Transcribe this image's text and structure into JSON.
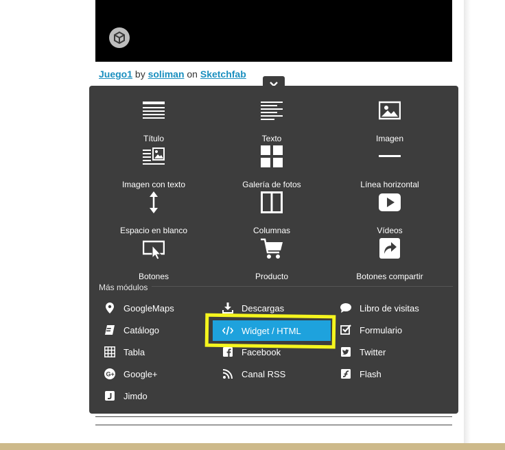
{
  "credit": {
    "model_link": "Juego1",
    "by": "by",
    "author_link": "soliman",
    "on": "on",
    "site_link": "Sketchfab"
  },
  "close_glyph": "✕",
  "tiles": [
    {
      "label": "Título",
      "icon": "title-icon"
    },
    {
      "label": "Texto",
      "icon": "text-icon"
    },
    {
      "label": "Imagen",
      "icon": "image-icon"
    },
    {
      "label": "Imagen con texto",
      "icon": "image-with-text-icon"
    },
    {
      "label": "Galería de fotos",
      "icon": "photo-gallery-icon"
    },
    {
      "label": "Línea horizontal",
      "icon": "horizontal-line-icon"
    },
    {
      "label": "Espacio en blanco",
      "icon": "spacer-icon"
    },
    {
      "label": "Columnas",
      "icon": "columns-icon"
    },
    {
      "label": "Vídeos",
      "icon": "video-icon"
    },
    {
      "label": "Botones",
      "icon": "button-icon"
    },
    {
      "label": "Producto",
      "icon": "cart-icon"
    },
    {
      "label": "Botones compartir",
      "icon": "share-icon"
    }
  ],
  "more_modules": {
    "title": "Más módulos",
    "items": [
      {
        "label": "GoogleMaps",
        "icon": "map-pin-icon"
      },
      {
        "label": "Descargas",
        "icon": "download-icon"
      },
      {
        "label": "Libro de visitas",
        "icon": "guestbook-icon"
      },
      {
        "label": "Catálogo",
        "icon": "catalog-icon"
      },
      {
        "label": "Widget / HTML",
        "icon": "code-icon",
        "selected": true
      },
      {
        "label": "Formulario",
        "icon": "form-icon"
      },
      {
        "label": "Tabla",
        "icon": "table-icon"
      },
      {
        "label": "Facebook",
        "icon": "facebook-icon"
      },
      {
        "label": "Twitter",
        "icon": "twitter-icon"
      },
      {
        "label": "Google+",
        "icon": "google-plus-icon"
      },
      {
        "label": "Canal RSS",
        "icon": "rss-icon"
      },
      {
        "label": "Flash",
        "icon": "flash-icon"
      },
      {
        "label": "Jimdo",
        "icon": "jimdo-icon"
      }
    ]
  },
  "colors": {
    "panel": "#3d3d3d",
    "accent": "#1ea2dd",
    "highlight": "#f5f51e",
    "link": "#1a8fbf"
  }
}
